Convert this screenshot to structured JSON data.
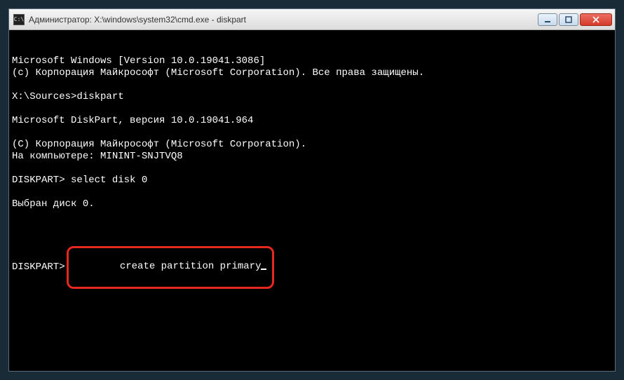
{
  "titlebar": {
    "icon_label": "C:\\",
    "title": "Администратор: X:\\windows\\system32\\cmd.exe - diskpart"
  },
  "console": {
    "lines": [
      "Microsoft Windows [Version 10.0.19041.3086]",
      "(c) Корпорация Майкрософт (Microsoft Corporation). Все права защищены.",
      "",
      "X:\\Sources>diskpart",
      "",
      "Microsoft DiskPart, версия 10.0.19041.964",
      "",
      "(C) Корпорация Майкрософт (Microsoft Corporation).",
      "На компьютере: MININT-SNJTVQ8",
      "",
      "DISKPART> select disk 0",
      "",
      "Выбран диск 0.",
      ""
    ],
    "final_prompt": "DISKPART>",
    "final_command": "create partition primary"
  }
}
